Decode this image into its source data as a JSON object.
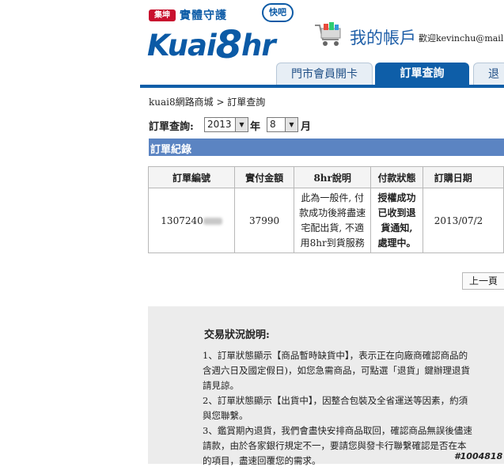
{
  "brand": {
    "badge": "集坤",
    "tagline": "實體守護",
    "name_part1": "Kuai",
    "name_digit": "8",
    "name_part2": "hr",
    "bubble": "快吧"
  },
  "header": {
    "account_title": "我的帳戶",
    "welcome": "歡迎kevinchu@mail"
  },
  "tabs": [
    {
      "label": "門市會員開卡",
      "active": false
    },
    {
      "label": "訂單查詢",
      "active": true
    },
    {
      "label": "退",
      "active": false
    }
  ],
  "breadcrumb": "kuai8網路商城 > 訂單查詢",
  "filter": {
    "label": "訂單查詢:",
    "year": "2013",
    "year_unit": "年",
    "month": "8",
    "month_unit": "月"
  },
  "section_title": "訂單紀錄",
  "table": {
    "headers": [
      "訂單編號",
      "實付金額",
      "8hr說明",
      "付款狀態",
      "訂購日期"
    ],
    "rows": [
      {
        "order_no": "1307240",
        "amount": "37990",
        "desc_lines": [
          "此為一般件, 付",
          "款成功後將盡速",
          "宅配出貨, 不適",
          "用8hr到貨服務"
        ],
        "status_lines": [
          "授權成功",
          "已收到退",
          "貨通知,",
          "處理中。"
        ],
        "date": "2013/07/2"
      }
    ]
  },
  "pagination": {
    "prev": "上一頁"
  },
  "notice": {
    "title": "交易狀況說明:",
    "lines": [
      "1、訂單狀態顯示【商品暫時缺貨中】，表示正在向廠商確認商品的",
      "含週六日及國定假日)，如您急需商品，可點選「退貨」鍵辦理退貨",
      "請見諒。",
      "2、訂單狀態顯示【出貨中】，因整合包裝及全省運送等因素，約須",
      "與您聯繫。",
      "3、鑑賞期內退貨，我們會盡快安排商品取回，確認商品無誤後儘速",
      "請款，由於各家銀行規定不一，要請您與發卡行聯繫確認是否在本",
      "的項目，盡速回覆您的需求。"
    ]
  },
  "watermark": "#1004818",
  "colors": {
    "brand_blue": "#0b5aa6",
    "tab_active": "#0e5ea8",
    "section_bar": "#5b84c2",
    "status_blue": "#1f6fc5"
  }
}
